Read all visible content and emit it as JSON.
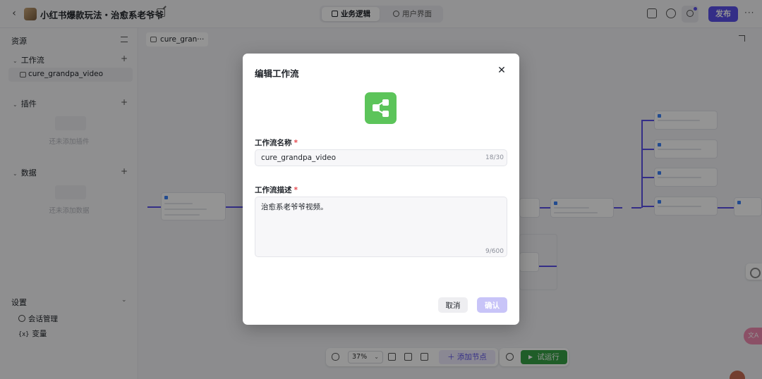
{
  "header": {
    "title": "小红书爆款玩法・治愈系老爷爷",
    "tabs": [
      {
        "label": "业务逻辑",
        "active": true
      },
      {
        "label": "用户界面",
        "active": false
      }
    ],
    "publish_label": "发布",
    "more_label": "···",
    "accent_color": "#5b50e8"
  },
  "sidebar": {
    "title": "资源",
    "workflow_section": "工作流",
    "workflow_item": "cure_grandpa_video",
    "plugin_section": "插件",
    "plugin_empty": "还未添加插件",
    "data_section": "数据",
    "data_empty": "还未添加数据",
    "settings_title": "设置",
    "settings_items": [
      "会话管理",
      "变量"
    ],
    "variable_icon_text": "{x}"
  },
  "canvas": {
    "tab_label": "cure_gran···",
    "toolbar": {
      "zoom": "37%",
      "add_node_label": "添加节点",
      "run_label": "试运行",
      "run_color": "#36a046"
    },
    "translate_badge": "文A"
  },
  "modal": {
    "title": "编辑工作流",
    "icon_color": "#5cc45a",
    "name_label": "工作流名称",
    "name_value": "cure_grandpa_video",
    "name_counter": "18/30",
    "desc_label": "工作流描述",
    "desc_value": "治愈系老爷爷视频。",
    "desc_counter": "9/600",
    "cancel_label": "取消",
    "confirm_label": "确认"
  }
}
